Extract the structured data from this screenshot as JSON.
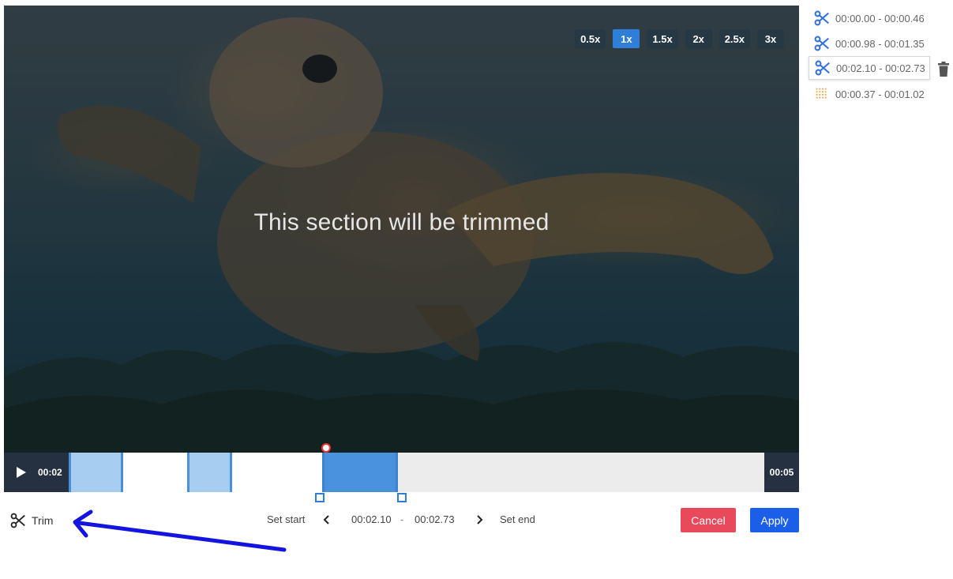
{
  "video": {
    "message": "This section will be trimmed",
    "speeds": [
      {
        "label": "0.5x",
        "active": false
      },
      {
        "label": "1x",
        "active": true
      },
      {
        "label": "1.5x",
        "active": false
      },
      {
        "label": "2x",
        "active": false
      },
      {
        "label": "2.5x",
        "active": false
      },
      {
        "label": "3x",
        "active": false
      }
    ]
  },
  "timeline": {
    "current_time": "00:02",
    "end_time": "00:05"
  },
  "controls": {
    "trim_label": "Trim",
    "set_start_label": "Set start",
    "start_value": "00:02.10",
    "separator": "-",
    "end_value": "00:02.73",
    "set_end_label": "Set end",
    "cancel_label": "Cancel",
    "apply_label": "Apply"
  },
  "clips": [
    {
      "range": "00:00.00 - 00:00.46",
      "icon": "scissors-icon"
    },
    {
      "range": "00:00.98 - 00:01.35",
      "icon": "scissors-icon"
    },
    {
      "range": "00:02.10 - 00:02.73",
      "icon": "scissors-icon",
      "selected": true
    },
    {
      "range": "00:00.37 - 00:01.02",
      "icon": "dotted-grid-icon"
    }
  ],
  "colors": {
    "accent": "#2f7ed8",
    "cancel": "#e8495b",
    "apply": "#1b5fe8",
    "clip_light": "#a7cdf0",
    "clip_active": "#4a93dc"
  }
}
